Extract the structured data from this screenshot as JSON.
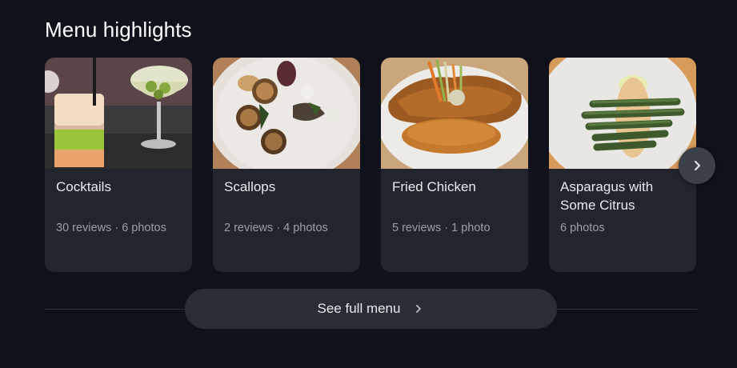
{
  "section": {
    "title": "Menu highlights"
  },
  "cards": [
    {
      "name": "Cocktails",
      "meta": "30 reviews · 6 photos",
      "photo_icon": "cocktails-photo"
    },
    {
      "name": "Scallops",
      "meta": "2 reviews · 4 photos",
      "photo_icon": "scallops-photo"
    },
    {
      "name": "Fried Chicken",
      "meta": "5 reviews · 1 photo",
      "photo_icon": "fried-chicken-photo"
    },
    {
      "name": "Asparagus with Some Citrus",
      "meta": "6 photos",
      "photo_icon": "asparagus-photo"
    }
  ],
  "next_button": {
    "icon": "chevron-right-icon"
  },
  "full_menu": {
    "label": "See full menu",
    "icon": "chevron-right-icon"
  },
  "colors": {
    "background": "#0f121a",
    "card": "#22252e",
    "text_primary": "#e8eaed",
    "text_secondary": "#9aa0a6"
  }
}
